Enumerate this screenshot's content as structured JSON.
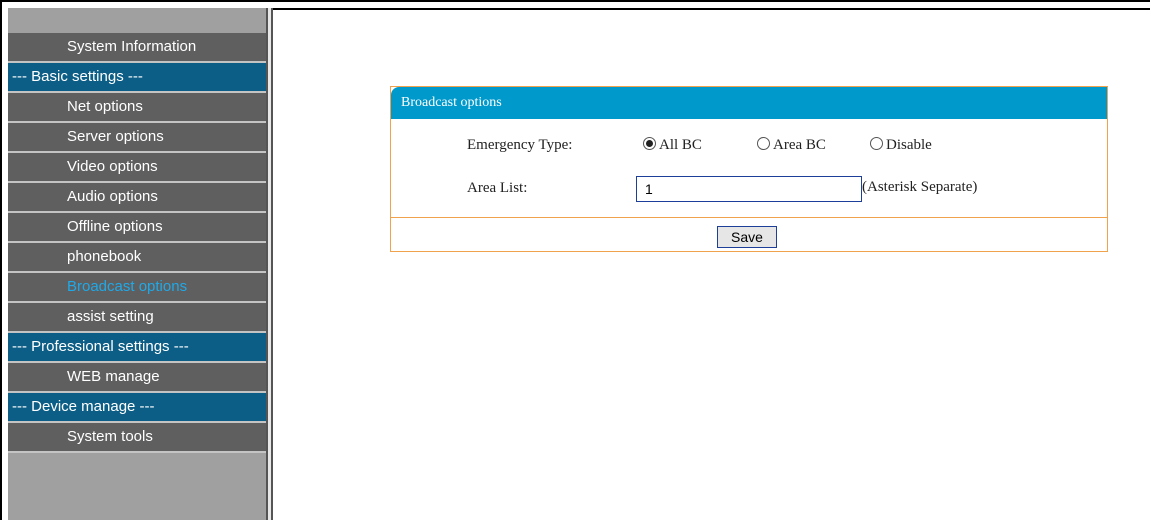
{
  "sidebar": {
    "items": [
      {
        "label": "System Information",
        "type": "link"
      },
      {
        "label": "--- Basic settings ---",
        "type": "section"
      },
      {
        "label": "Net options",
        "type": "link"
      },
      {
        "label": "Server options",
        "type": "link"
      },
      {
        "label": "Video options",
        "type": "link"
      },
      {
        "label": "Audio options",
        "type": "link"
      },
      {
        "label": "Offline options",
        "type": "link"
      },
      {
        "label": "phonebook",
        "type": "link"
      },
      {
        "label": "Broadcast options",
        "type": "link",
        "active": true
      },
      {
        "label": "assist setting",
        "type": "link"
      },
      {
        "label": "--- Professional settings ---",
        "type": "section"
      },
      {
        "label": "WEB manage",
        "type": "link"
      },
      {
        "label": "--- Device manage ---",
        "type": "section"
      },
      {
        "label": "System tools",
        "type": "link"
      }
    ]
  },
  "panel": {
    "title": "Broadcast options",
    "emergency_type": {
      "label": "Emergency Type:",
      "options": [
        {
          "label": "All BC",
          "checked": true
        },
        {
          "label": "Area BC",
          "checked": false
        },
        {
          "label": "Disable",
          "checked": false
        }
      ]
    },
    "area_list": {
      "label": "Area List:",
      "value": "1",
      "hint": "(Asterisk Separate)"
    },
    "save_label": "Save"
  },
  "colors": {
    "header_blue": "#0099cc",
    "section_blue": "#0c5e86",
    "active_link": "#1fa9e8",
    "panel_border": "#f0a34c"
  }
}
